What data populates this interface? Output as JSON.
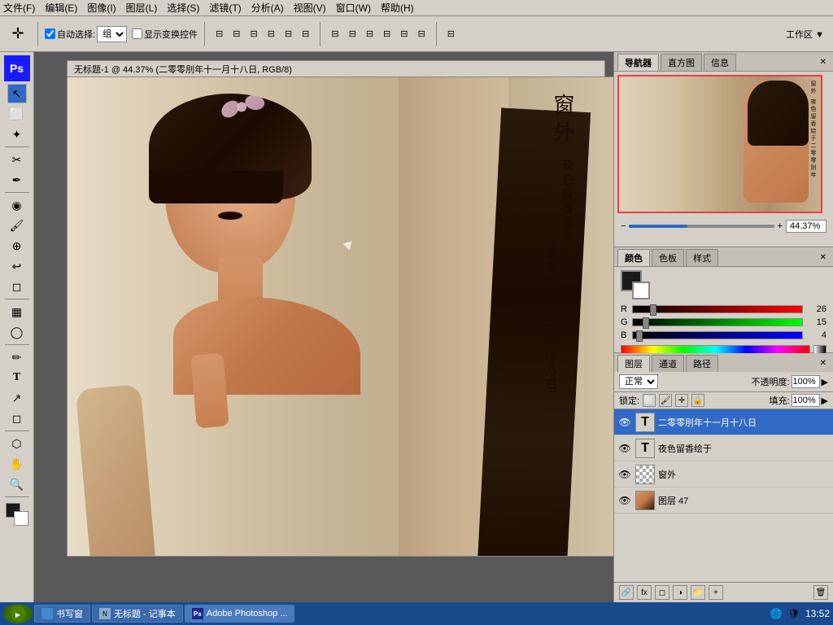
{
  "menubar": {
    "items": [
      "文件(F)",
      "编辑(E)",
      "图像(I)",
      "图层(L)",
      "选择(S)",
      "滤镜(T)",
      "分析(A)",
      "视图(V)",
      "窗口(W)",
      "帮助(H)"
    ]
  },
  "toolbar": {
    "auto_select_label": "自动选择:",
    "auto_select_option": "组",
    "show_transform": "显示变换控件",
    "workspace_label": "工作区 ▼"
  },
  "canvas": {
    "title": "无标题-1 @ 44.37% (二零零刖年十一月十八日, RGB/8)",
    "artwork_text_lines": [
      "窗",
      "外",
      "夜色留香绘于",
      "二零零刖年十一月十八日"
    ]
  },
  "navigator": {
    "tab": "导航器",
    "tab2": "直方图",
    "tab3": "信息",
    "zoom_value": "44.37%"
  },
  "color": {
    "tab": "颜色",
    "tab2": "色板",
    "tab3": "样式",
    "r_label": "R",
    "g_label": "G",
    "b_label": "B",
    "r_value": "26",
    "g_value": "15",
    "b_value": "4"
  },
  "layers": {
    "tab": "图层",
    "tab2": "通道",
    "tab3": "路径",
    "blend_mode": "正常",
    "opacity_label": "不透明度:",
    "opacity_value": "100%",
    "lock_label": "锁定:",
    "fill_label": "填充:",
    "fill_value": "100%",
    "items": [
      {
        "name": "二零零刖年十一月十八日",
        "type": "text",
        "selected": true,
        "visible": true
      },
      {
        "name": "夜色留香绘于",
        "type": "text",
        "selected": false,
        "visible": true
      },
      {
        "name": "窗外",
        "type": "normal",
        "selected": false,
        "visible": true
      },
      {
        "name": "图层 47",
        "type": "image",
        "selected": false,
        "visible": true
      }
    ]
  },
  "taskbar": {
    "items": [
      "书写窗",
      "无标题 - 记事本",
      "Adobe Photoshop ..."
    ],
    "time": "13:52"
  },
  "app_title": "Adobe Photoshop"
}
